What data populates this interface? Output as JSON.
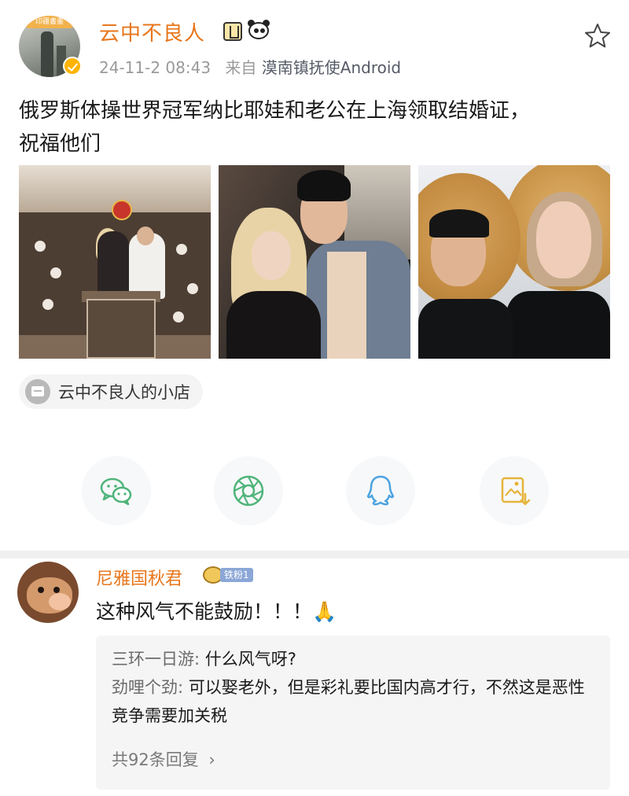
{
  "post": {
    "username": "云中不良人",
    "avatar_badge": "印疆書畫",
    "timestamp": "24-11-2 08:43",
    "source_prefix": "来自",
    "source_client": "漠南镇抚使Android",
    "text_line1": "俄罗斯体操世界冠军纳比耶娃和老公在上海领取结婚证，",
    "text_line2": "祝福他们",
    "shop_label": "云中不良人的小店"
  },
  "photos": [
    {
      "name": "photo-registry-office"
    },
    {
      "name": "photo-couple-night"
    },
    {
      "name": "photo-couple-straw-hats"
    }
  ],
  "share": [
    {
      "name": "wechat-share-button",
      "icon": "wechat-icon"
    },
    {
      "name": "moments-share-button",
      "icon": "moments-icon"
    },
    {
      "name": "qq-share-button",
      "icon": "qq-icon"
    },
    {
      "name": "save-image-button",
      "icon": "save-image-icon"
    }
  ],
  "comment": {
    "username": "尼雅国秋君",
    "fan_badge": "铁粉1",
    "text": "这种风气不能鼓励！！！🙏",
    "replies": [
      {
        "name": "三环一日游:",
        "text": " 什么风气呀?"
      },
      {
        "name": "劲哩个劲:",
        "text": " 可以娶老外，但是彩礼要比国内高才行，不然这是恶性竞争需要加关税"
      }
    ],
    "reply_count": "共92条回复",
    "reply_chevron": "›"
  },
  "colors": {
    "username": "#e8761b",
    "meta": "#9a9a9a",
    "share_green": "#4fb47a",
    "share_qq": "#4aa3e0",
    "share_save": "#e6b43c"
  }
}
